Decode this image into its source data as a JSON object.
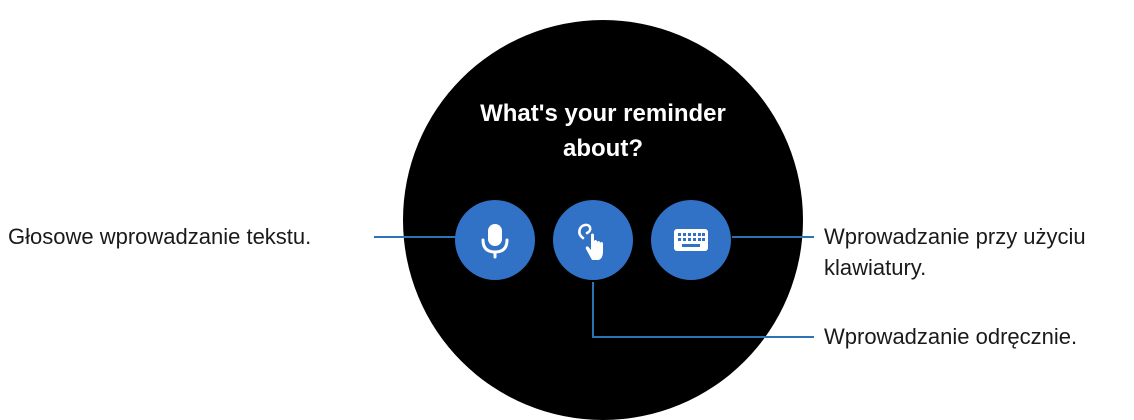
{
  "watch": {
    "prompt": "What's your reminder\nabout?",
    "buttons": [
      {
        "id": "voice",
        "icon": "microphone-icon"
      },
      {
        "id": "handwriting",
        "icon": "hand-drawing-icon"
      },
      {
        "id": "keyboard",
        "icon": "keyboard-icon"
      }
    ]
  },
  "callouts": {
    "voice": "Głosowe wprowadzanie tekstu.",
    "keyboard_line1": "Wprowadzanie przy użyciu",
    "keyboard_line2": "klawiatury.",
    "handwriting": "Wprowadzanie odręcznie."
  },
  "colors": {
    "button": "#3171c6",
    "leader_line": "#2e74b5",
    "watch_face": "#000000"
  }
}
